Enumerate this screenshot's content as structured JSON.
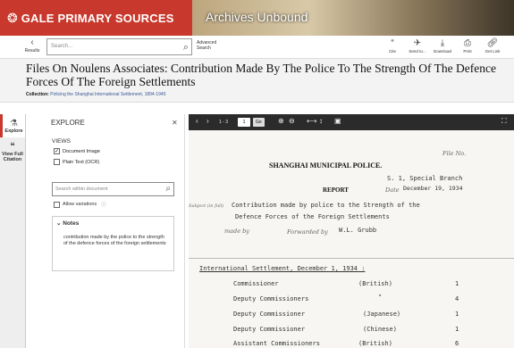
{
  "header": {
    "brand": "GALE PRIMARY SOURCES",
    "archive": "Archives Unbound"
  },
  "toolbar": {
    "results_label": "Results",
    "search_placeholder": "Search...",
    "advanced_search": "Advanced Search",
    "tools": [
      {
        "icon": "citation-icon",
        "label": "Cite"
      },
      {
        "icon": "send-icon",
        "label": "Send to..."
      },
      {
        "icon": "download-icon",
        "label": "Download"
      },
      {
        "icon": "print-icon",
        "label": "Print"
      },
      {
        "icon": "link-icon",
        "label": "Get Link"
      }
    ]
  },
  "document": {
    "title": "Files On Noulens Associates: Contribution Made By The Police To The Strength Of The Defence Forces Of The Foreign Settlements",
    "collection_label": "Collection:",
    "collection_value": "Policing the Shanghai International Settlement, 1894-1945"
  },
  "rail": {
    "explore": "Explore",
    "full_citation": "View Full Citation"
  },
  "explore": {
    "heading": "EXPLORE",
    "views_label": "VIEWS",
    "document_image": "Document Image",
    "plain_text": "Plain Text (OCR)",
    "search_within_placeholder": "Search within document",
    "allow_variations": "Allow variations",
    "notes_heading": "Notes",
    "notes_text": "contribution made by the police to the strength of the defence forces of the foreign settlements"
  },
  "viewer": {
    "page_range": "1 - 3",
    "page_number": "1",
    "go": "Go"
  },
  "scan": {
    "org": "SHANGHAI MUNICIPAL POLICE.",
    "file_no": "File No.",
    "branch": "S. 1, Special Branch",
    "report": "REPORT",
    "date_label": "Date",
    "date_value": "December 19, 1934",
    "subject_prefix": "Subject (in full)",
    "line1": "Contribution made by police to the Strength of the",
    "line2": "Defence Forces of the Foreign Settlements",
    "made_by": "made by",
    "forwarded_by": "Forwarded by",
    "forwarder": "W.L. Grubb",
    "section": "International Settlement, December 1, 1934 :",
    "rows": [
      {
        "rank": "Commissioner",
        "nat": "(British)",
        "n": "1"
      },
      {
        "rank": "Deputy Commissioners",
        "nat": "\"",
        "n": "4"
      },
      {
        "rank": "Deputy Commissioner",
        "nat": "(Japanese)",
        "n": "1"
      },
      {
        "rank": "Deputy Commissioner",
        "nat": "(Chinese)",
        "n": "1"
      },
      {
        "rank": "Assistant Commissioners",
        "nat": "(British)",
        "n": "6"
      }
    ]
  }
}
